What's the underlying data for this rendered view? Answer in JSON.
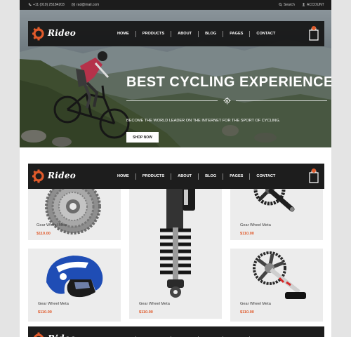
{
  "topbar": {
    "phone": "+11 (019) 25184203",
    "email": "rad@mail.com",
    "search": "Search",
    "account": "ACCOUNT"
  },
  "brand": {
    "name": "Rideo"
  },
  "nav": {
    "items": [
      "HOME",
      "PRODUCTS",
      "ABOUT",
      "BLOG",
      "PAGES",
      "CONTACT"
    ]
  },
  "hero": {
    "title": "BEST CYCLING EXPERIENCE",
    "subtitle": "BECOME THE WORLD LEADER ON THE INTERNET FOR THE SPORT OF CYCLING.",
    "button": "SHOP NOW"
  },
  "products": [
    {
      "name": "Gear Wheel Meta",
      "price": "$110.00",
      "icon": "cassette-gear-icon"
    },
    {
      "name": "Gear Wheel Meta",
      "price": "$110.00",
      "icon": "suspension-shock-icon"
    },
    {
      "name": "Gear Wheel Meta",
      "price": "$110.00",
      "icon": "crankset-icon"
    },
    {
      "name": "Gear Wheel Meta",
      "price": "$110.00",
      "icon": "helmet-icon"
    },
    {
      "name": "Gear Wheel Meta",
      "price": "$110.00",
      "icon": "crankset-icon"
    }
  ],
  "colors": {
    "accent": "#e05a2b",
    "nav_bg": "#1d1d1d",
    "card_bg": "#ececec",
    "page_bg": "#e4e4e4"
  }
}
